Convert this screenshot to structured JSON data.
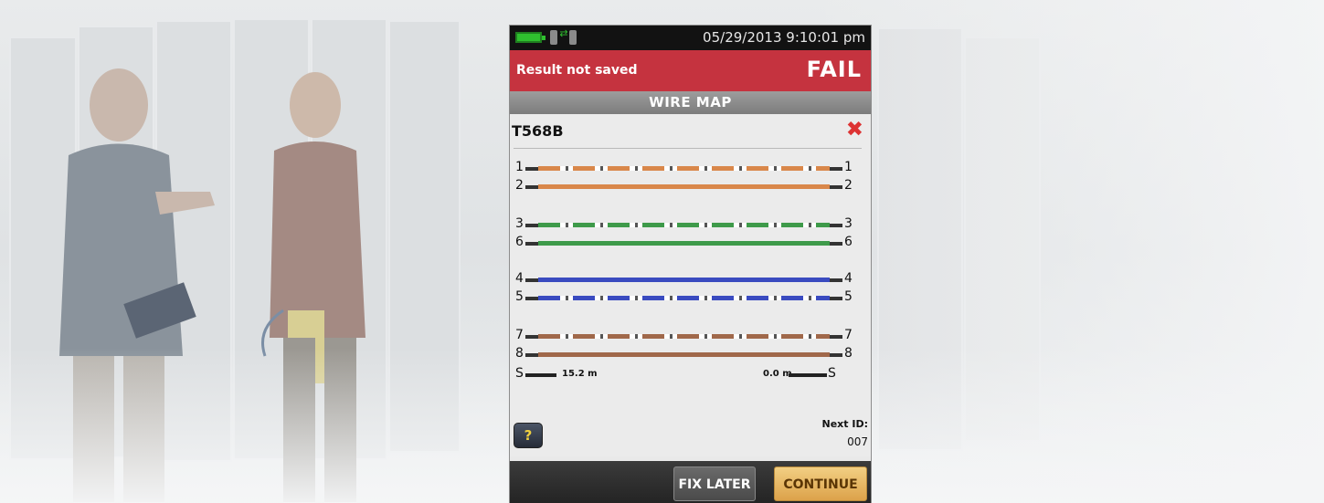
{
  "status_bar": {
    "datetime": "05/29/2013 9:10:01 pm",
    "icons": [
      "battery-icon",
      "link-icon"
    ]
  },
  "result": {
    "message": "Result not saved",
    "status": "FAIL",
    "status_color": "#c5333f"
  },
  "screen_title": "WIRE MAP",
  "wire_map": {
    "standard": "T568B",
    "result_icon": "fail-x-icon",
    "pins": [
      {
        "left": "1",
        "right": "1",
        "color": "#d9874a",
        "striped": true
      },
      {
        "left": "2",
        "right": "2",
        "color": "#d9874a",
        "striped": false
      },
      {
        "left": "3",
        "right": "3",
        "color": "#3e9a4a",
        "striped": true
      },
      {
        "left": "6",
        "right": "6",
        "color": "#3e9a4a",
        "striped": false
      },
      {
        "left": "4",
        "right": "4",
        "color": "#3a4bc0",
        "striped": false
      },
      {
        "left": "5",
        "right": "5",
        "color": "#3a4bc0",
        "striped": true
      },
      {
        "left": "7",
        "right": "7",
        "color": "#a0684a",
        "striped": true
      },
      {
        "left": "8",
        "right": "8",
        "color": "#a0684a",
        "striped": false
      }
    ],
    "shield": {
      "left_pin": "S",
      "right_pin": "S",
      "left_length": "15.2 m",
      "right_length": "0.0 m"
    }
  },
  "help_label": "?",
  "next_id": {
    "label": "Next ID:",
    "value": "007"
  },
  "buttons": {
    "fix_later": "FIX LATER",
    "continue": "CONTINUE"
  }
}
